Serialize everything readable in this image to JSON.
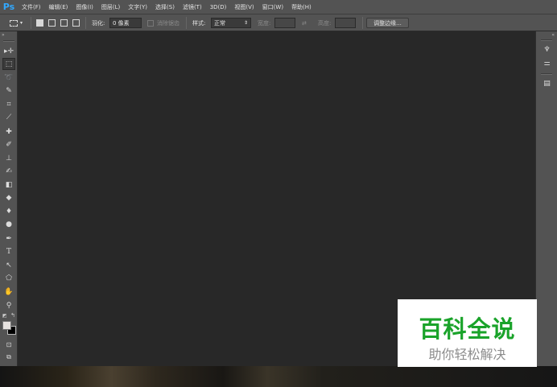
{
  "app": {
    "logo": "Ps"
  },
  "menu": [
    "文件(F)",
    "编辑(E)",
    "图像(I)",
    "图层(L)",
    "文字(Y)",
    "选择(S)",
    "滤镜(T)",
    "3D(D)",
    "视图(V)",
    "窗口(W)",
    "帮助(H)"
  ],
  "options": {
    "feather_label": "羽化:",
    "feather_value": "0 像素",
    "antialias_label": "消除锯齿",
    "style_label": "样式:",
    "style_value": "正常",
    "width_label": "宽度:",
    "height_label": "高度:",
    "refine_button": "调整边缘..."
  },
  "tools": [
    {
      "name": "move-tool",
      "glyph": "▸✛"
    },
    {
      "name": "marquee-tool",
      "glyph": "⬚",
      "active": true
    },
    {
      "name": "lasso-tool",
      "glyph": "➰"
    },
    {
      "name": "quick-select-tool",
      "glyph": "✎"
    },
    {
      "name": "crop-tool",
      "glyph": "⌗"
    },
    {
      "name": "eyedropper-tool",
      "glyph": "⟋"
    },
    {
      "name": "healing-brush-tool",
      "glyph": "✚"
    },
    {
      "name": "brush-tool",
      "glyph": "✐"
    },
    {
      "name": "clone-stamp-tool",
      "glyph": "⊥"
    },
    {
      "name": "history-brush-tool",
      "glyph": "✍"
    },
    {
      "name": "eraser-tool",
      "glyph": "◧"
    },
    {
      "name": "paint-bucket-tool",
      "glyph": "◆"
    },
    {
      "name": "blur-tool",
      "glyph": "♦"
    },
    {
      "name": "dodge-tool",
      "glyph": "●"
    },
    {
      "name": "pen-tool",
      "glyph": "✒"
    },
    {
      "name": "type-tool",
      "glyph": "T"
    },
    {
      "name": "path-select-tool",
      "glyph": "↖"
    },
    {
      "name": "shape-tool",
      "glyph": "⬠"
    },
    {
      "name": "hand-tool",
      "glyph": "✋"
    },
    {
      "name": "zoom-tool",
      "glyph": "⚲"
    }
  ],
  "watermark": {
    "title": "百科全说",
    "subtitle": "助你轻松解决"
  }
}
